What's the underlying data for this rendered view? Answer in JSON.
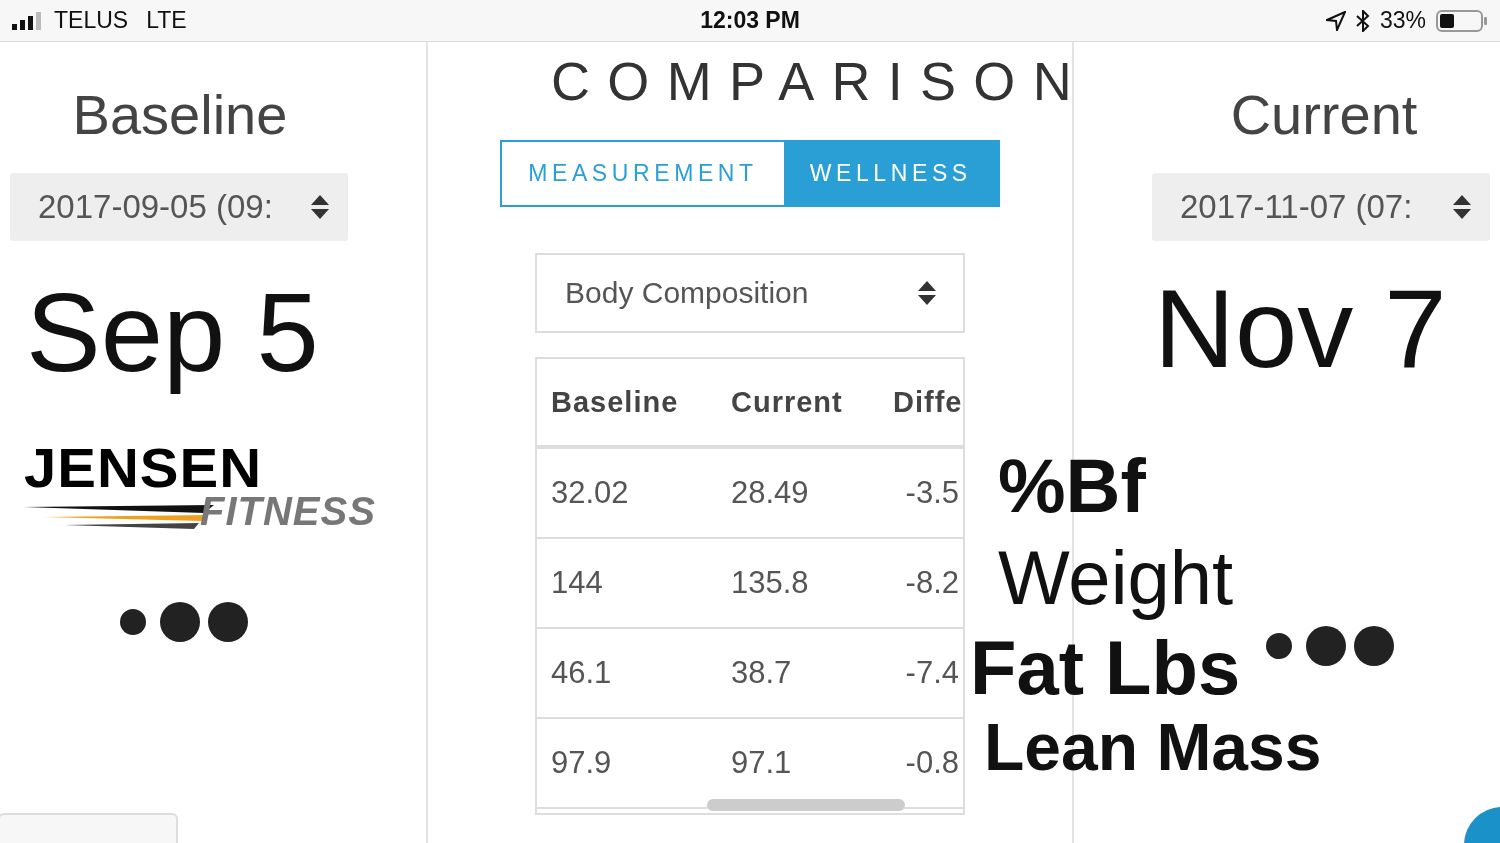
{
  "status_bar": {
    "carrier": "TELUS",
    "network": "LTE",
    "time": "12:03 PM",
    "battery": "33%"
  },
  "baseline": {
    "title": "Baseline",
    "date_select": "2017-09-05 (09:",
    "date_label": "Sep 5"
  },
  "logo": {
    "name": "JENSEN",
    "tagline": "FITNESS"
  },
  "comparison": {
    "title": "COMPARISON",
    "tabs": [
      {
        "label": "MEASUREMENT",
        "selected": false
      },
      {
        "label": "WELLNESS",
        "selected": true
      }
    ],
    "category_select": "Body Composition",
    "table": {
      "columns": [
        "Baseline",
        "Current",
        "Diffe"
      ],
      "rows": [
        [
          "32.02",
          "28.49",
          "-3.5"
        ],
        [
          "144",
          "135.8",
          "-8.2"
        ],
        [
          "46.1",
          "38.7",
          "-7.4"
        ],
        [
          "97.9",
          "97.1",
          "-0.8"
        ]
      ]
    }
  },
  "current": {
    "title": "Current",
    "date_select": "2017-11-07 (07:",
    "date_label": "Nov 7"
  },
  "overlay_labels": [
    {
      "text": "%Bf",
      "bold": true
    },
    {
      "text": "Weight",
      "bold": false
    },
    {
      "text": "Fat Lbs",
      "bold": true
    },
    {
      "text": "Lean Mass",
      "bold": true
    }
  ]
}
